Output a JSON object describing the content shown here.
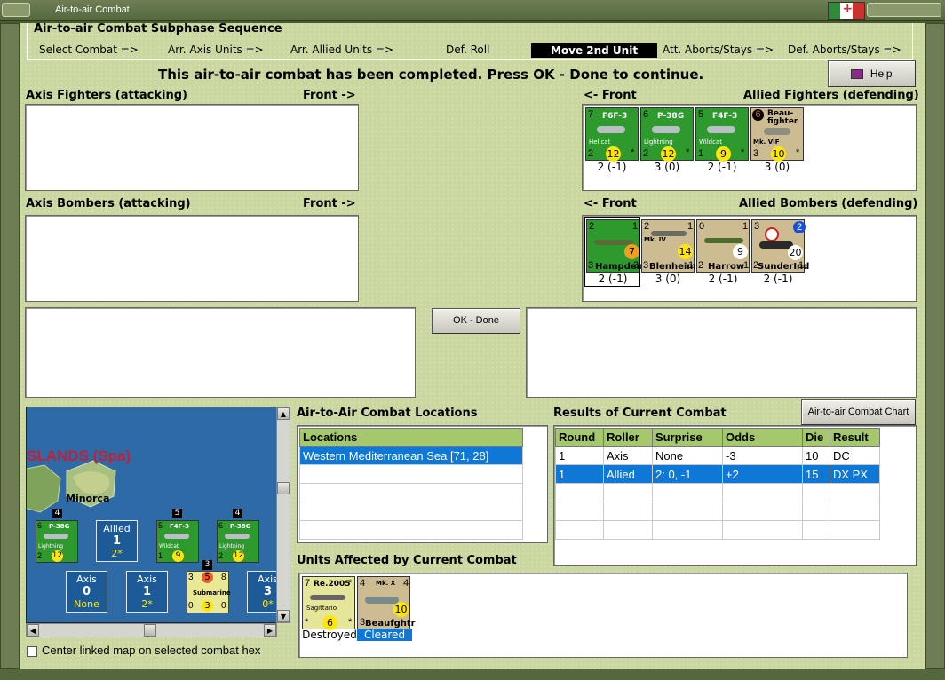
{
  "window": {
    "title": "Air-to-air Combat"
  },
  "phase": {
    "title": "Air-to-air Combat Subphase Sequence",
    "steps": [
      "Select Combat =>",
      "Arr. Axis Units =>",
      "Arr. Allied Units =>",
      "Def. Roll",
      "Move 2nd Unit",
      "Att. Aborts/Stays =>",
      "Def. Aborts/Stays =>"
    ],
    "active_step": "Move 2nd Unit"
  },
  "message": "This air-to-air combat has been completed.  Press OK - Done to continue.",
  "help_label": "Help",
  "axis_fighters": {
    "label": "Axis Fighters (attacking)",
    "front": "Front ->"
  },
  "axis_bombers": {
    "label": "Axis Bombers (attacking)",
    "front": "Front ->"
  },
  "allied_fighters": {
    "label": "Allied Fighters (defending)",
    "front": "<- Front",
    "units": [
      {
        "top_left": "7",
        "name": "F6F-3",
        "sub": "Hellcat",
        "bl": "2",
        "yellow": "12",
        "br": "*",
        "value": "2 (-1)",
        "color": "green"
      },
      {
        "top_left": "6",
        "name": "P-38G",
        "sub": "Lightning",
        "bl": "2",
        "yellow": "12",
        "br": "*",
        "value": "3 (0)",
        "color": "green"
      },
      {
        "top_left": "5",
        "name": "F4F-3",
        "sub": "Wildcat",
        "bl": "1",
        "yellow": "9",
        "br": "*",
        "value": "2 (-1)",
        "color": "green"
      },
      {
        "top_left": "6",
        "name": "Beau-fighter",
        "sub": "Mk. VIF",
        "bl": "3",
        "yellow": "10",
        "br": "*",
        "value": "3 (0)",
        "color": "tan"
      }
    ]
  },
  "allied_bombers": {
    "label": "Allied Bombers (defending)",
    "front": "<- Front",
    "units": [
      {
        "tl": "2",
        "tr": "1",
        "name": "Hampden",
        "bl": "3",
        "br": "3",
        "mid": "7",
        "value": "2 (-1)",
        "color": "green"
      },
      {
        "tl": "2",
        "tr": "1",
        "name": "Blenheim",
        "sub": "Mk. IV",
        "bl": "3",
        "br": "1",
        "mid": "14",
        "value": "3 (0)",
        "color": "tan"
      },
      {
        "tl": "0",
        "tr": "1",
        "name": "Harrow",
        "bl": "2",
        "br": "1",
        "mid": "9",
        "value": "2 (-1)",
        "color": "tan"
      },
      {
        "tl": "3",
        "tr": "2",
        "name": "SunderInd",
        "bl": "2",
        "br": "1",
        "mid": "20",
        "value": "2 (-1)",
        "color": "tan"
      }
    ]
  },
  "ok_done_label": "OK - Done",
  "combat_chart_label": "Air-to-air Combat Chart",
  "locations": {
    "label": "Air-to-Air Combat Locations",
    "header": "Locations",
    "rows": [
      "Western Mediterranean Sea [71, 28]"
    ]
  },
  "results": {
    "label": "Results of Current Combat",
    "headers": [
      "Round",
      "Roller",
      "Surprise",
      "Odds",
      "Die",
      "Result"
    ],
    "rows": [
      [
        "1",
        "Axis",
        "None",
        "-3",
        "10",
        "DC"
      ],
      [
        "1",
        "Allied",
        "2: 0, -1",
        "+2",
        "15",
        "DX PX"
      ]
    ]
  },
  "affected": {
    "label": "Units Affected by Current Combat",
    "units": [
      {
        "name": "Re.2005",
        "sub": "Sagittario",
        "tl": "7",
        "tr": "*",
        "bl": "*",
        "yellow": "6",
        "br": "*",
        "status": "Destroyed"
      },
      {
        "name": "Beaufghtr",
        "sub": "Mk. X",
        "tl": "4",
        "tr": "4",
        "bl": "3",
        "yellow": "10",
        "br": "",
        "status": "Cleared"
      }
    ]
  },
  "map": {
    "region": "SLANDS (Spa)",
    "island": "Minorca",
    "allied_box": {
      "title": "Allied",
      "count": "1",
      "sub": "2*"
    },
    "axis_boxes": [
      {
        "title": "Axis",
        "count": "0",
        "sub": "None"
      },
      {
        "title": "Axis",
        "count": "1",
        "sub": "2*"
      },
      {
        "title": "Axis",
        "count": "3",
        "sub": "0*"
      }
    ],
    "stack_counts": [
      "4",
      "5",
      "4",
      "3"
    ],
    "units": [
      {
        "name": "P-38G",
        "tl": "6",
        "bl": "2",
        "yellow": "12",
        "sub": "Lightning"
      },
      {
        "name": "F4F-3",
        "tl": "5",
        "bl": "1",
        "yellow": "9",
        "sub": "Wildcat"
      },
      {
        "name": "P-38G",
        "tl": "6",
        "bl": "2",
        "yellow": "12",
        "sub": "Lightning"
      }
    ],
    "sub_unit": {
      "tl": "3",
      "red": "5",
      "tr": "8",
      "name": "Submarine",
      "bl": "0",
      "yellow": "3",
      "br": "0"
    }
  },
  "center_map_label": "Center linked map on selected combat hex",
  "colors": {
    "panel_bg": "#cad7a0",
    "green_counter": "#2e9a2e",
    "tan_counter": "#cdbb92",
    "selection": "#0f78d6"
  }
}
